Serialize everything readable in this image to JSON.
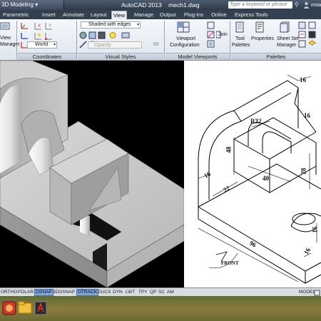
{
  "title_bar": {
    "workspace": "3D Modeling",
    "app_title": "AutoCAD 2013",
    "file_name": "mech1.dwg",
    "search_placeholder": "Type a keyword or phrase",
    "user": "msal"
  },
  "tabs": [
    "Parametric",
    "Insert",
    "Annotate",
    "Layout",
    "View",
    "Manage",
    "Output",
    "Plug-ins",
    "Online",
    "Express Tools"
  ],
  "active_tab": "View",
  "ribbon": {
    "view_manager_label": [
      "View",
      "Manager"
    ],
    "coordinates_label": "Coordinates",
    "ucs_value": "World",
    "visual_style_value": "Shaded with edges",
    "opacity_label": "Opacity",
    "opacity_value": "60",
    "visual_styles_label": "Visual Styles",
    "viewport_config_label": [
      "Viewport",
      "Configuration"
    ],
    "join_label": "Join",
    "model_viewports_label": "Model Viewports",
    "tool_palettes_label": [
      "Tool",
      "Palettes"
    ],
    "properties_label": "Properties",
    "sheet_set_label": [
      "Sheet Set",
      "Manager"
    ],
    "palettes_label": "Palettes"
  },
  "drawing": {
    "dimensions": {
      "top_width": "16",
      "radius": "R32",
      "slot_width": "16",
      "height_48": "48",
      "side_16": "16",
      "width_40": "40",
      "height_28": "28",
      "depth_22": "22",
      "right_16": "16",
      "bottom_16": "16",
      "length_96": "96"
    },
    "front_label": "FRONT"
  },
  "status_bar": [
    "ORTHO",
    "POLAR",
    "OSNAP",
    "3DOSNAP",
    "OTRACK",
    "DUCS",
    "DYN",
    "LWT",
    "TPY",
    "QP",
    "SC",
    "AM"
  ],
  "status_on": [
    "OSNAP",
    "OTRACK"
  ],
  "status_right": "MODEL"
}
